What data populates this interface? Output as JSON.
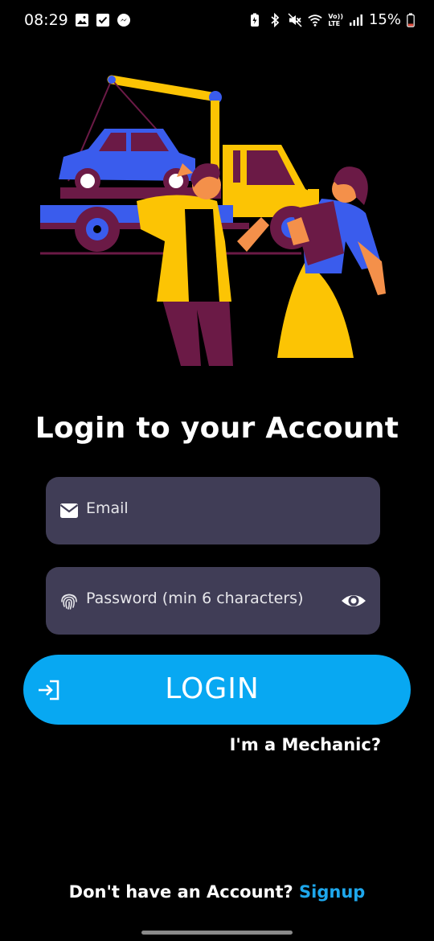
{
  "status_bar": {
    "time": "08:29",
    "battery_percent": "15%",
    "left_icons": [
      "gallery-icon",
      "checkbox-icon",
      "messenger-icon"
    ],
    "right_icons": [
      "battery-saver-icon",
      "bluetooth-icon",
      "mute-icon",
      "wifi-icon",
      "volte-icon",
      "signal-icon",
      "battery-icon"
    ],
    "volte_top": "Vo))",
    "volte_bottom": "LTE"
  },
  "illustration": {
    "description_icon": "tow-truck-illustration",
    "colors": {
      "truck_yellow": "#fcc404",
      "car_blue": "#3a5ced",
      "maroon": "#6b1a46",
      "skin": "#f4904a"
    }
  },
  "title": "Login to your Account",
  "email": {
    "placeholder": "Email",
    "icon": "mail-icon"
  },
  "password": {
    "placeholder": "Password (min 6 characters)",
    "icon": "fingerprint-icon",
    "toggle_icon": "eye-icon"
  },
  "login_button": {
    "label": "LOGIN",
    "icon": "login-arrow-icon",
    "color": "#08a8f2"
  },
  "mechanic_link": "I'm a Mechanic?",
  "signup": {
    "prompt": "Don't have an Account?",
    "link": "Signup",
    "link_color": "#1ea7ec"
  },
  "colors": {
    "background": "#000000",
    "field_bg": "#403d56"
  }
}
